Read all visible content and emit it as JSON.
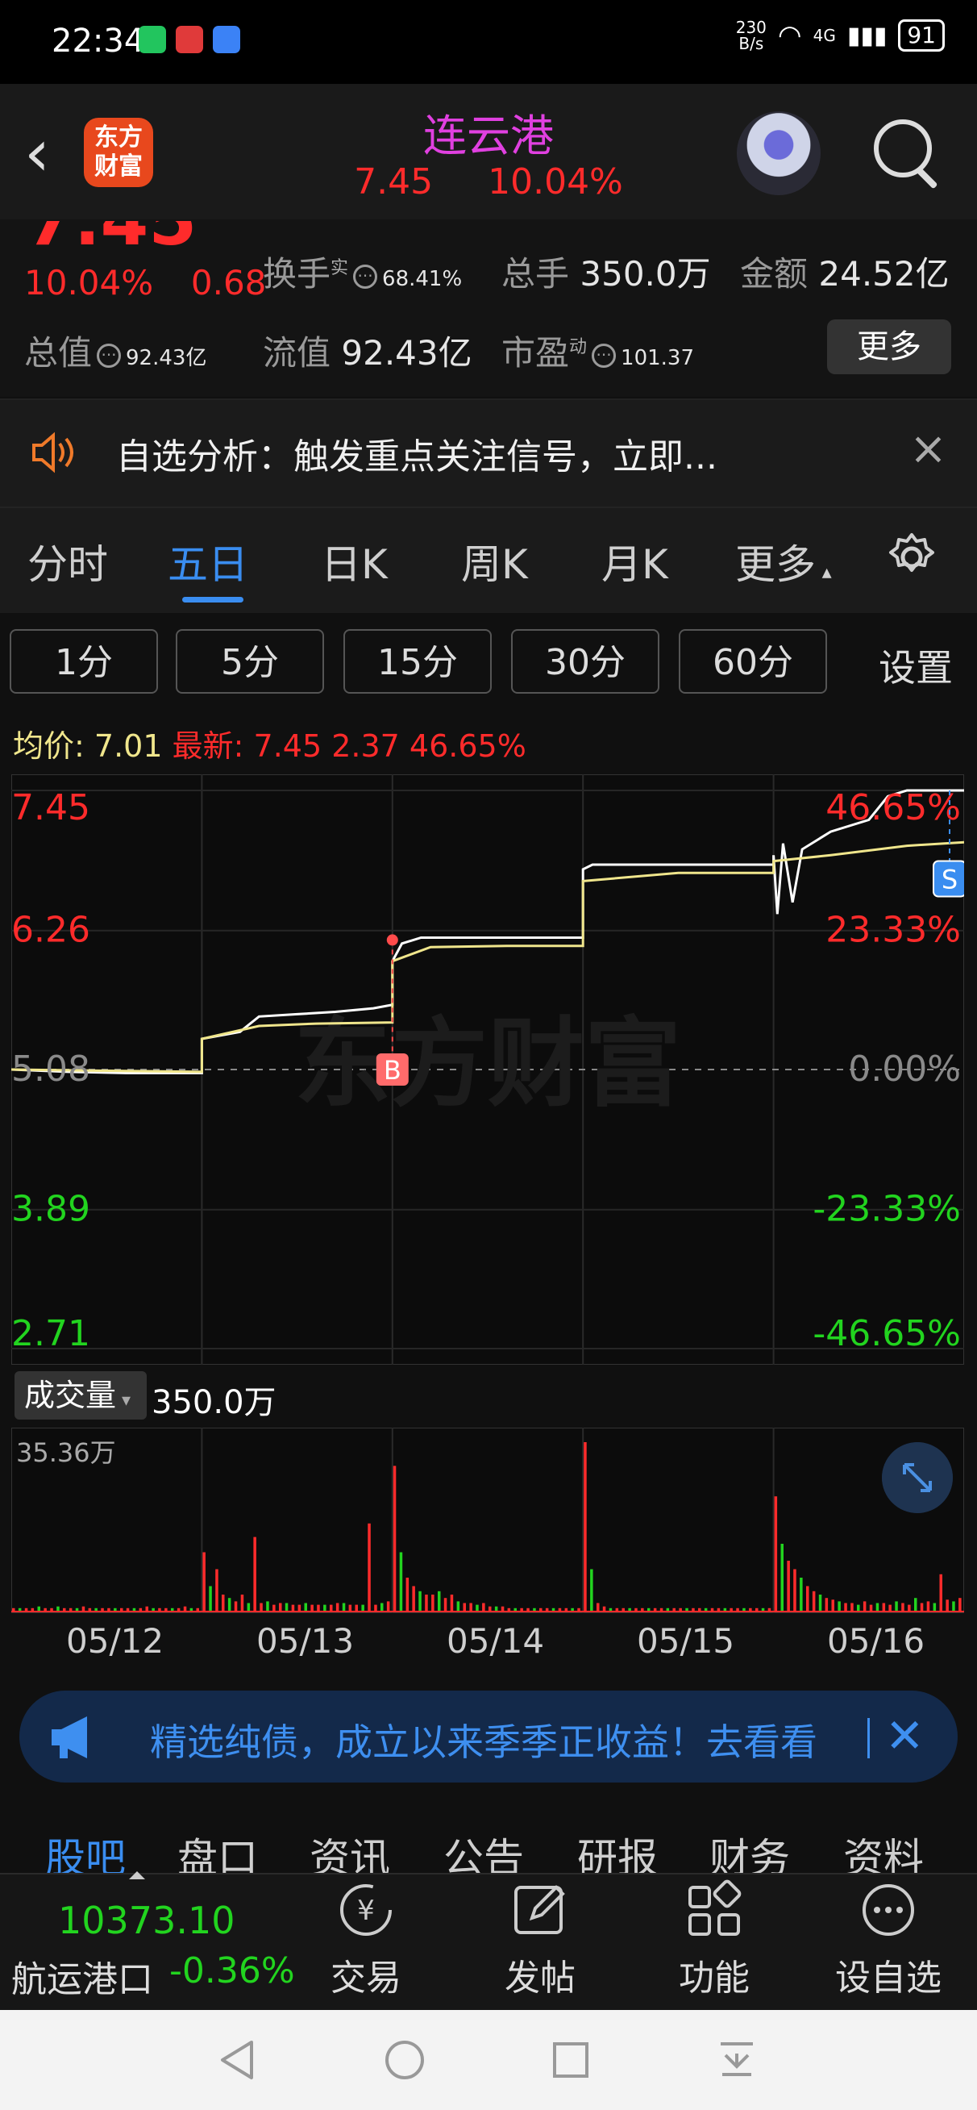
{
  "status_bar": {
    "time": "22:34",
    "net_speed_top": "230",
    "net_speed_bottom": "B/s",
    "network": "4G",
    "battery": "91"
  },
  "nav": {
    "logo_top": "东方",
    "logo_bottom": "财富",
    "title": "连云港",
    "price": "7.45",
    "change_pct": "10.04%"
  },
  "quote": {
    "price_partial": "7.45",
    "change_pct": "10.04%",
    "change": "0.68",
    "turnover_label": "换手",
    "turnover_sup": "实",
    "turnover_value": "68.41%",
    "volume_label": "总手",
    "volume_value": "350.0万",
    "amount_label": "金额",
    "amount_value": "24.52亿",
    "total_value_label": "总值",
    "total_value": "92.43亿",
    "float_value_label": "流值",
    "float_value": "92.43亿",
    "pe_label": "市盈",
    "pe_sup": "动",
    "pe_value": "101.37",
    "more_button": "更多"
  },
  "notice": {
    "text": "自选分析：触发重点关注信号，立即..."
  },
  "tabs": [
    "分时",
    "五日",
    "日K",
    "周K",
    "月K",
    "更多"
  ],
  "active_tab": "五日",
  "minute_buttons": [
    "1分",
    "5分",
    "15分",
    "30分",
    "60分"
  ],
  "settings_label": "设置",
  "avg_line": {
    "avg_label": "均价:",
    "avg_value": "7.01",
    "latest_label": "最新:",
    "latest_value": "7.45",
    "change": "2.37",
    "change_pct": "46.65%"
  },
  "chart_data": {
    "type": "line",
    "title": "",
    "y_left_ticks": [
      "7.45",
      "6.26",
      "5.08",
      "3.89",
      "2.71"
    ],
    "y_right_ticks": [
      "46.65%",
      "23.33%",
      "0.00%",
      "-23.33%",
      "-46.65%"
    ],
    "ylim": [
      2.71,
      7.45
    ],
    "baseline": 5.08,
    "x_categories": [
      "05/12",
      "05/13",
      "05/14",
      "05/15",
      "05/16"
    ],
    "series": [
      {
        "name": "",
        "color": "#ffffff",
        "values": [
          [
            0.0,
            5.08
          ],
          [
            0.3,
            5.06
          ],
          [
            0.6,
            5.05
          ],
          [
            1.0,
            5.05
          ],
          [
            1.0,
            5.34
          ],
          [
            1.2,
            5.4
          ],
          [
            1.3,
            5.53
          ],
          [
            1.5,
            5.55
          ],
          [
            1.7,
            5.57
          ],
          [
            1.9,
            5.6
          ],
          [
            2.0,
            5.63
          ],
          [
            2.0,
            6.0
          ],
          [
            2.05,
            6.15
          ],
          [
            2.15,
            6.2
          ],
          [
            2.5,
            6.2
          ],
          [
            3.0,
            6.2
          ],
          [
            3.0,
            6.78
          ],
          [
            3.05,
            6.82
          ],
          [
            3.5,
            6.82
          ],
          [
            4.0,
            6.82
          ],
          [
            4.0,
            6.9
          ],
          [
            4.02,
            6.4
          ],
          [
            4.05,
            7.0
          ],
          [
            4.1,
            6.5
          ],
          [
            4.15,
            6.95
          ],
          [
            4.3,
            7.1
          ],
          [
            4.5,
            7.2
          ],
          [
            4.6,
            7.4
          ],
          [
            4.7,
            7.45
          ],
          [
            5.0,
            7.45
          ]
        ]
      },
      {
        "name": "",
        "color": "#f0e68c",
        "values": [
          [
            0.0,
            5.08
          ],
          [
            0.5,
            5.07
          ],
          [
            1.0,
            5.06
          ],
          [
            1.0,
            5.34
          ],
          [
            1.3,
            5.45
          ],
          [
            1.6,
            5.47
          ],
          [
            2.0,
            5.48
          ],
          [
            2.0,
            6.0
          ],
          [
            2.2,
            6.12
          ],
          [
            2.6,
            6.13
          ],
          [
            3.0,
            6.13
          ],
          [
            3.0,
            6.68
          ],
          [
            3.5,
            6.75
          ],
          [
            4.0,
            6.75
          ],
          [
            4.0,
            6.85
          ],
          [
            4.3,
            6.9
          ],
          [
            4.7,
            6.98
          ],
          [
            5.0,
            7.01
          ]
        ]
      }
    ],
    "markers": [
      {
        "label": "B",
        "day": 2.0,
        "price": 5.08
      },
      {
        "label": "S",
        "day": 5.0,
        "price": 6.7
      }
    ],
    "watermark": "东方财富"
  },
  "volume": {
    "selector_label": "成交量",
    "value": "350.0万",
    "max_label": "35.36万",
    "bars": [
      [
        0.02,
        0.02,
        0.02,
        0.02,
        0.03,
        0.02,
        0.02,
        0.03,
        0.02,
        0.02,
        0.02,
        0.03,
        0.02,
        0.02,
        0.02,
        0.02,
        0.02,
        0.02,
        0.02,
        0.02,
        0.02,
        0.03,
        0.02,
        0.02,
        0.02,
        0.02,
        0.02,
        0.03,
        0.02,
        0.02
      ],
      [
        0.35,
        0.15,
        0.25,
        0.1,
        0.08,
        0.06,
        0.1,
        0.05,
        0.44,
        0.05,
        0.06,
        0.04,
        0.05,
        0.05,
        0.04,
        0.04,
        0.05,
        0.04,
        0.04,
        0.04,
        0.04,
        0.05,
        0.05,
        0.04,
        0.04,
        0.04,
        0.52,
        0.04,
        0.05,
        0.06
      ],
      [
        0.86,
        0.35,
        0.2,
        0.15,
        0.12,
        0.1,
        0.1,
        0.12,
        0.08,
        0.1,
        0.06,
        0.05,
        0.05,
        0.04,
        0.05,
        0.03,
        0.03,
        0.03,
        0.02,
        0.02,
        0.02,
        0.02,
        0.02,
        0.02,
        0.02,
        0.02,
        0.02,
        0.02,
        0.02,
        0.02
      ],
      [
        1.0,
        0.25,
        0.05,
        0.03,
        0.02,
        0.02,
        0.02,
        0.02,
        0.02,
        0.02,
        0.02,
        0.02,
        0.02,
        0.02,
        0.02,
        0.02,
        0.02,
        0.02,
        0.02,
        0.02,
        0.02,
        0.02,
        0.02,
        0.02,
        0.02,
        0.02,
        0.02,
        0.02,
        0.02,
        0.02
      ],
      [
        0.68,
        0.4,
        0.3,
        0.25,
        0.2,
        0.15,
        0.12,
        0.1,
        0.08,
        0.07,
        0.06,
        0.05,
        0.05,
        0.04,
        0.06,
        0.04,
        0.05,
        0.05,
        0.04,
        0.06,
        0.05,
        0.04,
        0.08,
        0.05,
        0.06,
        0.05,
        0.22,
        0.07,
        0.06,
        0.08
      ]
    ]
  },
  "ad": {
    "text": "精选纯债，成立以来季季正收益！去看看"
  },
  "subtabs": [
    "股吧",
    "盘口",
    "资讯",
    "公告",
    "研报",
    "财务",
    "资料"
  ],
  "active_subtab": "股吧",
  "toolbar": {
    "index_value": "10373.10",
    "index_name": "航运港口",
    "index_change": "-0.36%",
    "items": [
      "交易",
      "发帖",
      "功能",
      "设自选"
    ]
  },
  "colors": {
    "up": "#ff2b2b",
    "down": "#22d41f",
    "accent": "#3a8df0",
    "title": "#e040e0",
    "price_line": "#ffffff",
    "avg_line": "#f0e68c"
  }
}
